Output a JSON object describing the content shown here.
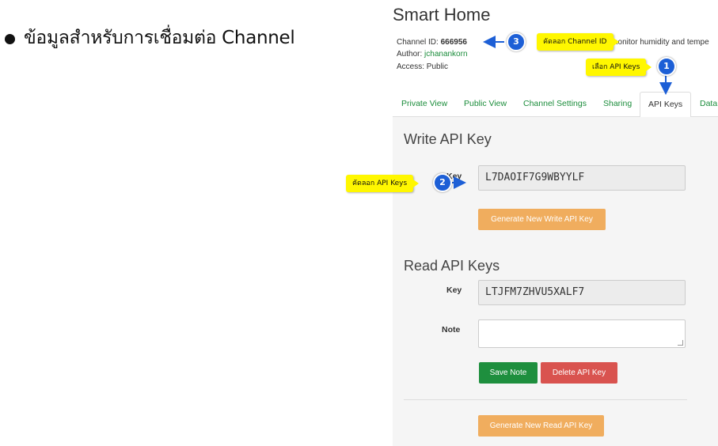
{
  "slide": {
    "heading": "ข้อมูลสำหรับการเชื่อมต่อ Channel"
  },
  "channel": {
    "title": "Smart Home",
    "id_label": "Channel ID:",
    "id_value": "666956",
    "author_label": "Author:",
    "author_value": "jchanankorn",
    "access_label": "Access:",
    "access_value": "Public",
    "description": "nonitor humidity and tempe"
  },
  "tabs": [
    "Private View",
    "Public View",
    "Channel Settings",
    "Sharing",
    "API Keys",
    "Data"
  ],
  "active_tab": "API Keys",
  "write_section": {
    "title": "Write API Key",
    "key_label": "Key",
    "key_value": "L7DAOIF7G9WBYYLF",
    "generate_button": "Generate New Write API Key"
  },
  "read_section": {
    "title": "Read API Keys",
    "key_label": "Key",
    "key_value": "LTJFM7ZHVU5XALF7",
    "note_label": "Note",
    "save_button": "Save Note",
    "delete_button": "Delete API Key",
    "generate_button": "Generate New Read API Key"
  },
  "annotations": {
    "step1_label": "เลือก API Keys",
    "step1_num": "1",
    "step2_label": "คัดลอก API Keys",
    "step2_num": "2",
    "step3_label": "คัดลอก Channel ID",
    "step3_num": "3",
    "badge_color": "#1d5fd6",
    "callout_color": "#fff700"
  },
  "colors": {
    "link_green": "#1a8c3a",
    "button_orange": "#f0ad5e",
    "button_green": "#1e8f3e",
    "button_red": "#d9534f"
  }
}
